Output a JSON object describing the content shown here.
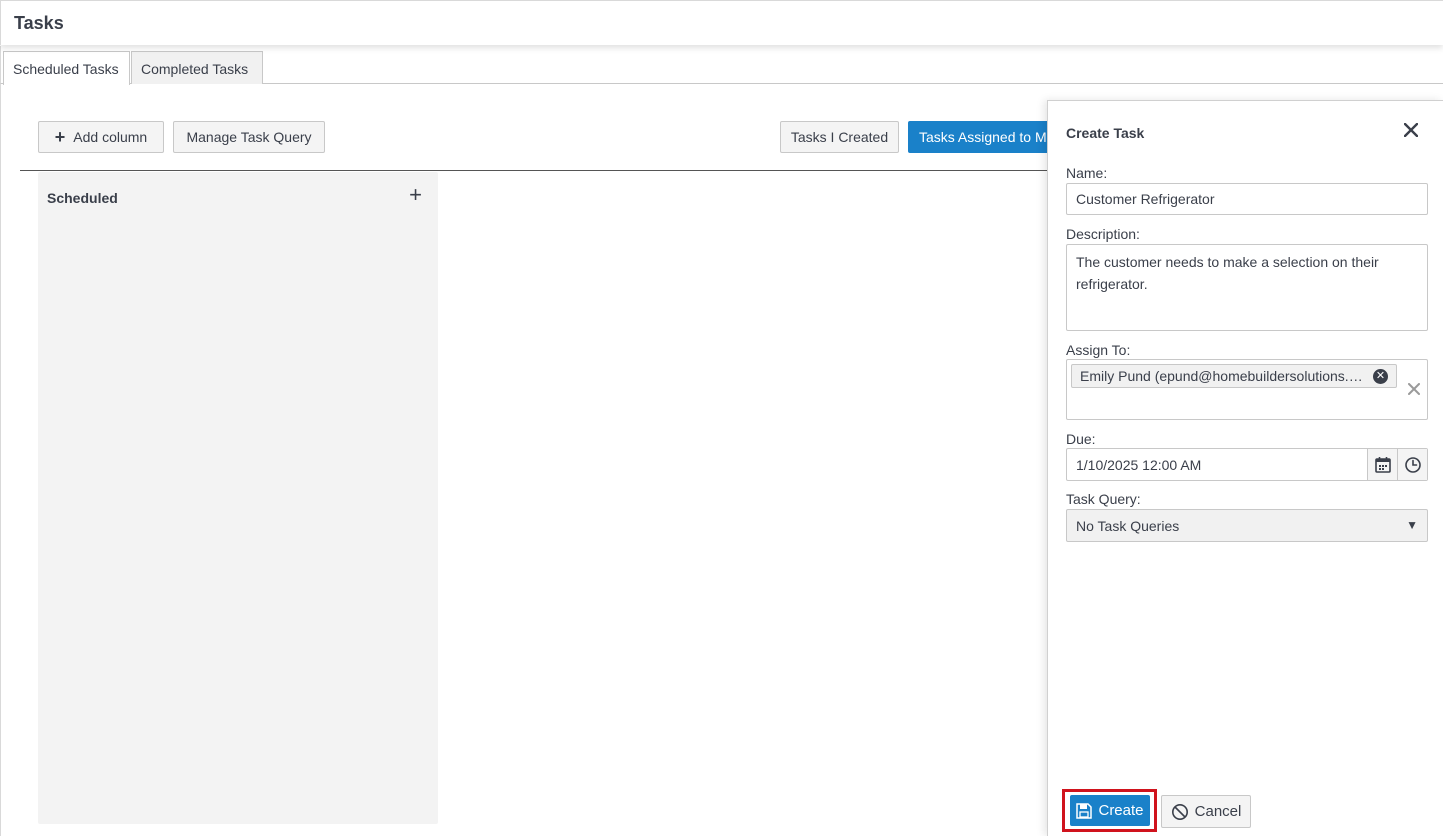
{
  "header": {
    "title": "Tasks"
  },
  "tabs": [
    {
      "label": "Scheduled Tasks",
      "active": true
    },
    {
      "label": "Completed Tasks",
      "active": false
    }
  ],
  "toolbar": {
    "add_column_label": "Add column",
    "manage_query_label": "Manage Task Query",
    "tasks_created_label": "Tasks I Created",
    "tasks_assigned_label": "Tasks Assigned to Me"
  },
  "board": {
    "columns": [
      {
        "title": "Scheduled"
      }
    ]
  },
  "create_panel": {
    "title": "Create Task",
    "name_label": "Name:",
    "name_value": "Customer Refrigerator",
    "description_label": "Description:",
    "description_value": "The customer needs to make a selection on their refrigerator.",
    "assign_label": "Assign To:",
    "assignee": "Emily Pund (epund@homebuildersolutions.com)",
    "due_label": "Due:",
    "due_value": "1/10/2025 12:00 AM",
    "query_label": "Task Query:",
    "query_value": "No Task Queries",
    "create_label": "Create",
    "cancel_label": "Cancel"
  },
  "colors": {
    "primary": "#1a81c9",
    "highlight": "#d0131d",
    "column_bg": "#f3f3f3"
  }
}
